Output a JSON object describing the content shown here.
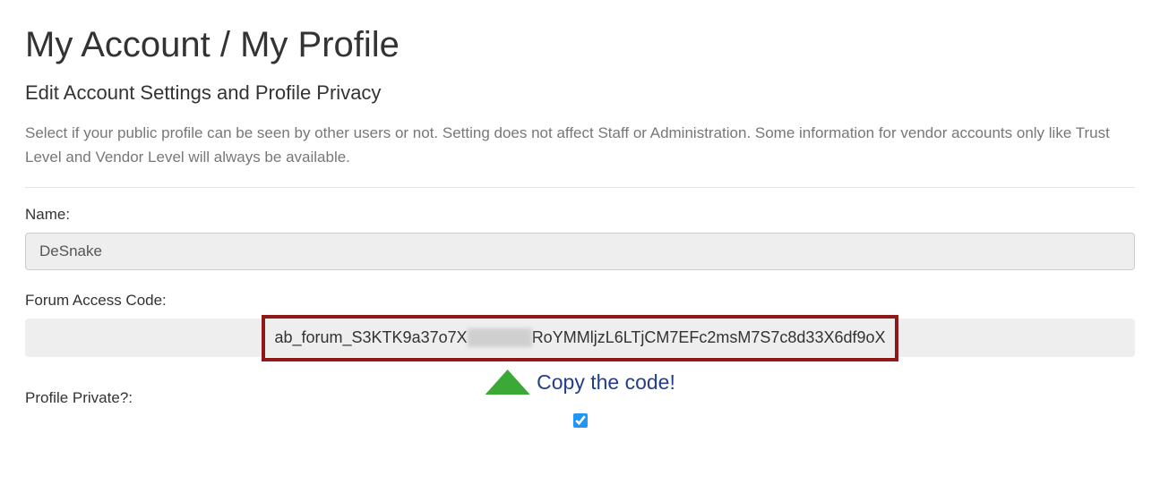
{
  "page": {
    "title": "My Account / My Profile",
    "subtitle": "Edit Account Settings and Profile Privacy",
    "description": "Select if your public profile can be seen by other users or not. Setting does not affect Staff or Administration. Some information for vendor accounts only like Trust Level and Vendor Level will always be available."
  },
  "fields": {
    "name_label": "Name:",
    "name_value": "DeSnake",
    "code_label": "Forum Access Code:",
    "code_value_prefix": "ab_forum_S3KTK9a37o7X",
    "code_value_hidden": "XXXXXX",
    "code_value_suffix": "RoYMMljzL6LTjCM7EFc2msM7S7c8d33X6df9oX",
    "privacy_label": "Profile Private?:",
    "privacy_checked": true
  },
  "callout": {
    "copy_label": "Copy the code!"
  }
}
